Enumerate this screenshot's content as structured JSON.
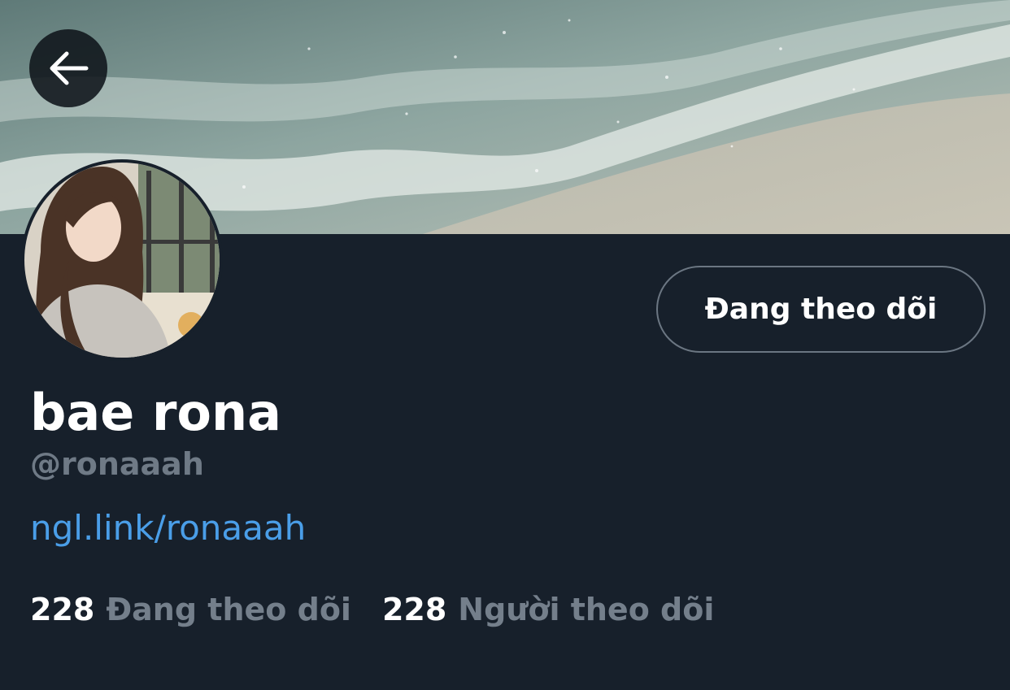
{
  "header": {
    "back_icon": "arrow-left-icon",
    "banner_image": "ocean-waves-on-beach"
  },
  "profile": {
    "avatar_image": "woman-with-long-hair-at-cafe",
    "display_name": "bae rona",
    "handle": "@ronaaah",
    "link": "ngl.link/ronaaah",
    "follow_button_label": "Đang theo dõi"
  },
  "stats": {
    "following_count": "228",
    "following_label": "Đang theo dõi",
    "followers_count": "228",
    "followers_label": "Người theo dõi"
  },
  "colors": {
    "background": "#17202b",
    "link": "#4a9ee8",
    "muted": "#747f8b",
    "button_border": "#6b7682"
  }
}
